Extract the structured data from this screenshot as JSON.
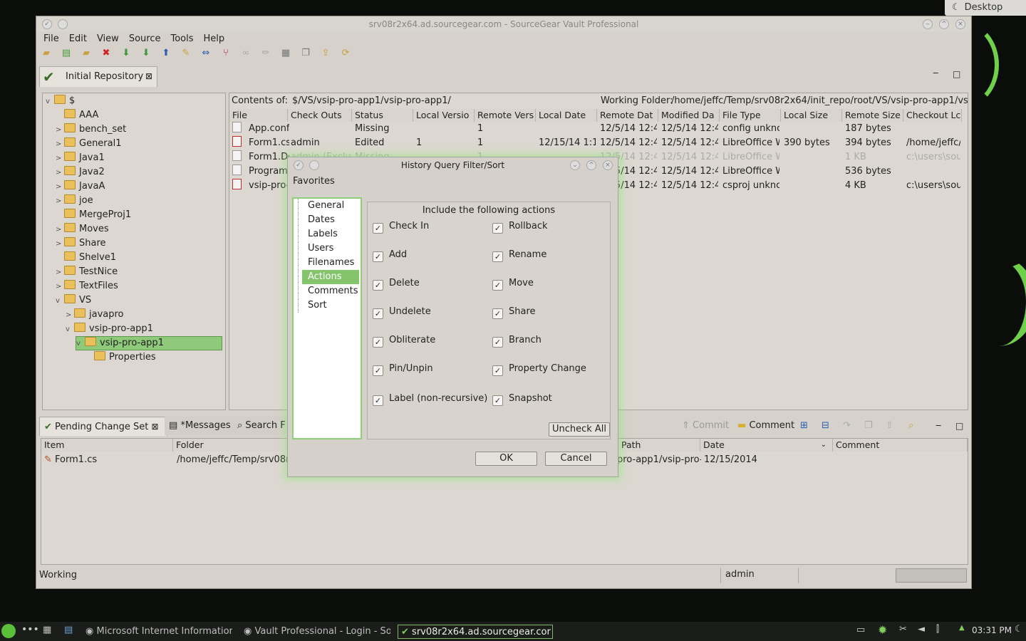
{
  "desktop": {
    "button_label": "Desktop"
  },
  "window": {
    "title": "srv08r2x64.ad.sourcegear.com - SourceGear Vault Professional"
  },
  "menu": [
    "File",
    "Edit",
    "View",
    "Source",
    "Tools",
    "Help"
  ],
  "repo_tab": {
    "label": "Initial Repository"
  },
  "tree": {
    "items": [
      {
        "label": "$",
        "level": 0,
        "expander": "v"
      },
      {
        "label": "AAA",
        "level": 1,
        "expander": ""
      },
      {
        "label": "bench_set",
        "level": 1,
        "expander": ">"
      },
      {
        "label": "General1",
        "level": 1,
        "expander": ">"
      },
      {
        "label": "Java1",
        "level": 1,
        "expander": ">"
      },
      {
        "label": "Java2",
        "level": 1,
        "expander": ">"
      },
      {
        "label": "JavaA",
        "level": 1,
        "expander": ">"
      },
      {
        "label": "joe",
        "level": 1,
        "expander": ">"
      },
      {
        "label": "MergeProj1",
        "level": 1,
        "expander": ""
      },
      {
        "label": "Moves",
        "level": 1,
        "expander": ">"
      },
      {
        "label": "Share",
        "level": 1,
        "expander": ">"
      },
      {
        "label": "Shelve1",
        "level": 1,
        "expander": ""
      },
      {
        "label": "TestNice",
        "level": 1,
        "expander": ">"
      },
      {
        "label": "TextFiles",
        "level": 1,
        "expander": ">"
      },
      {
        "label": "VS",
        "level": 1,
        "expander": "v"
      },
      {
        "label": "javapro",
        "level": 2,
        "expander": ">"
      },
      {
        "label": "vsip-pro-app1",
        "level": 2,
        "expander": "v"
      },
      {
        "label": "vsip-pro-app1",
        "level": 3,
        "expander": "v",
        "selected": true
      },
      {
        "label": "Properties",
        "level": 4,
        "expander": ""
      }
    ]
  },
  "contents": {
    "label": "Contents of:",
    "path": "$/VS/vsip-pro-app1/vsip-pro-app1/",
    "working_label": "Working Folder:",
    "working_path": "/home/jeffc/Temp/srv08r2x64/init_repo/root/VS/vsip-pro-app1/vsip-p"
  },
  "file_columns": [
    "File",
    "Check Outs",
    "Status",
    "Local Versio",
    "Remote Vers",
    "Local Date",
    "Remote Dat",
    "Modified Da",
    "File Type",
    "Local Size",
    "Remote Size",
    "Checkout Lc"
  ],
  "files": [
    [
      "App.confi",
      "",
      "Missing",
      "",
      "1",
      "",
      "12/5/14 12:4",
      "12/5/14 12:4",
      "config unknc",
      "",
      "187 bytes",
      ""
    ],
    [
      "Form1.cs",
      "admin",
      "Edited",
      "1",
      "1",
      "12/15/14 1:1",
      "12/5/14 12:4",
      "12/5/14 12:4",
      "LibreOffice W",
      "390 bytes",
      "394 bytes",
      "/home/jeffc/T"
    ],
    [
      "Form1.De",
      "admin (Exclu",
      "Missing",
      "",
      "1",
      "",
      "12/5/14 12:4",
      "12/5/14 12:4",
      "LibreOffice W",
      "",
      "1 KB",
      "c:\\users\\sou"
    ],
    [
      "Program.",
      "",
      "",
      "",
      "",
      "",
      "12/5/14 12:4",
      "12/5/14 12:4",
      "LibreOffice W",
      "",
      "536 bytes",
      ""
    ],
    [
      "vsip-pro-",
      "",
      "",
      "",
      "",
      "",
      "12/5/14 12:4",
      "12/5/14 12:4",
      "csproj unknc",
      "",
      "4 KB",
      "c:\\users\\sou"
    ]
  ],
  "bottom_tabs": [
    "Pending Change Set",
    "*Messages",
    "Search F"
  ],
  "bottom_actions": [
    "Commit",
    "Comment"
  ],
  "pending_columns": [
    "Item",
    "Folder",
    "Path",
    "Date",
    "Comment"
  ],
  "pending_rows": [
    {
      "item": "Form1.cs",
      "folder": "/home/jeffc/Temp/srv08r2",
      "path": "pro-app1/vsip-pro-a",
      "date": "12/15/2014",
      "comment": ""
    }
  ],
  "status": {
    "left": "Working",
    "user": "admin"
  },
  "dialog": {
    "title": "History Query Filter/Sort",
    "favorites": "Favorites",
    "nav": [
      "General",
      "Dates",
      "Labels",
      "Users",
      "Filenames",
      "Actions",
      "Comments",
      "Sort"
    ],
    "selected_nav": "Actions",
    "heading": "Include the following actions",
    "actions_left": [
      "Check In",
      "Add",
      "Delete",
      "Undelete",
      "Obliterate",
      "Pin/Unpin",
      "Label (non-recursive)"
    ],
    "actions_right": [
      "Rollback",
      "Rename",
      "Move",
      "Share",
      "Branch",
      "Property Change",
      "Snapshot"
    ],
    "uncheck_all": "Uncheck All",
    "ok": "OK",
    "cancel": "Cancel"
  },
  "taskbar": {
    "tasks": [
      "Microsoft Internet Informatior",
      "Vault Professional - Login - So",
      "srv08r2x64.ad.sourcegear.cor"
    ],
    "clock": "03:31 PM"
  },
  "colors": {
    "accent": "#84c56c",
    "glow": "#96e678"
  }
}
